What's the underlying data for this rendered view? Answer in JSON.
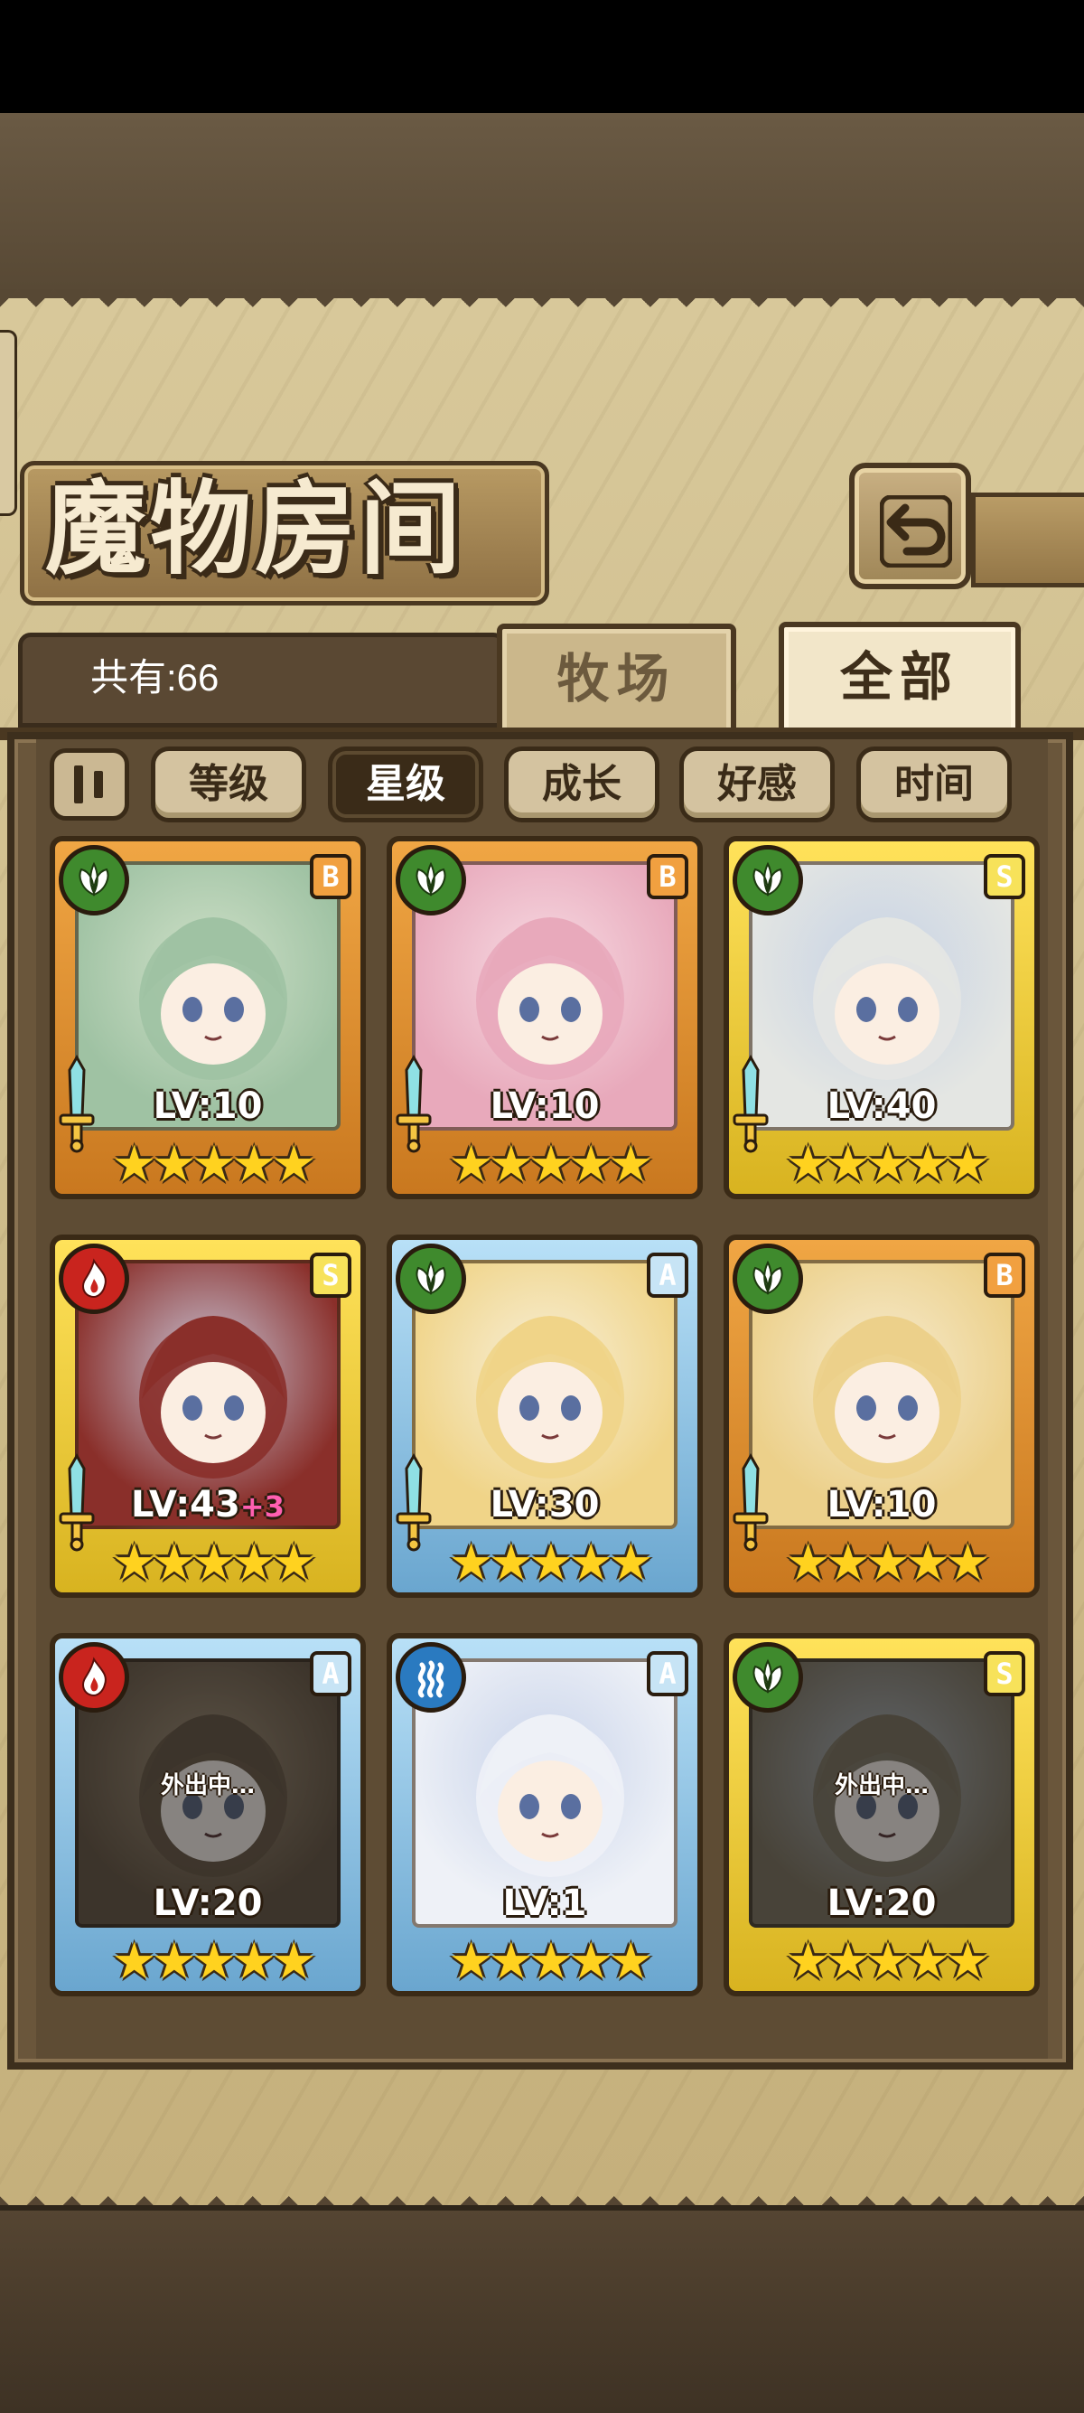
{
  "header": {
    "title": "魔物房间",
    "count_text": "共有:66",
    "back_icon": "back-arrow-icon"
  },
  "tabs": [
    {
      "label": "牧场",
      "active": false
    },
    {
      "label": "全部",
      "active": true
    }
  ],
  "sort": {
    "toggle_icon": "sort-order-icon",
    "buttons": [
      {
        "label": "等级",
        "active": false
      },
      {
        "label": "星级",
        "active": true
      },
      {
        "label": "成长",
        "active": false
      },
      {
        "label": "好感",
        "active": false
      },
      {
        "label": "时间",
        "active": false
      }
    ]
  },
  "monsters": [
    {
      "element": "leaf",
      "rank": "B",
      "level": "LV:10",
      "bonus": "",
      "stars": 5,
      "status": "",
      "frame": "orange"
    },
    {
      "element": "leaf",
      "rank": "B",
      "level": "LV:10",
      "bonus": "",
      "stars": 5,
      "status": "",
      "frame": "orange"
    },
    {
      "element": "leaf",
      "rank": "S",
      "level": "LV:40",
      "bonus": "",
      "stars": 5,
      "status": "",
      "frame": "gold"
    },
    {
      "element": "fire",
      "rank": "S",
      "level": "LV:43",
      "bonus": "+3",
      "stars": 5,
      "status": "",
      "frame": "gold"
    },
    {
      "element": "leaf",
      "rank": "A",
      "level": "LV:30",
      "bonus": "",
      "stars": 5,
      "status": "",
      "frame": "blue"
    },
    {
      "element": "leaf",
      "rank": "B",
      "level": "LV:10",
      "bonus": "",
      "stars": 5,
      "status": "",
      "frame": "orange"
    },
    {
      "element": "fire",
      "rank": "A",
      "level": "LV:20",
      "bonus": "",
      "stars": 5,
      "status": "外出中…",
      "frame": "blue"
    },
    {
      "element": "water",
      "rank": "A",
      "level": "LV:1",
      "bonus": "",
      "stars": 5,
      "status": "",
      "frame": "blue"
    },
    {
      "element": "leaf",
      "rank": "S",
      "level": "LV:20",
      "bonus": "",
      "stars": 5,
      "status": "外出中…",
      "frame": "gold"
    }
  ],
  "colors": {
    "leaf": "#3f8a2d",
    "fire": "#c9241e",
    "water": "#2a7ac0",
    "star": "#ffd21f",
    "bonus": "#ff5fb0"
  }
}
